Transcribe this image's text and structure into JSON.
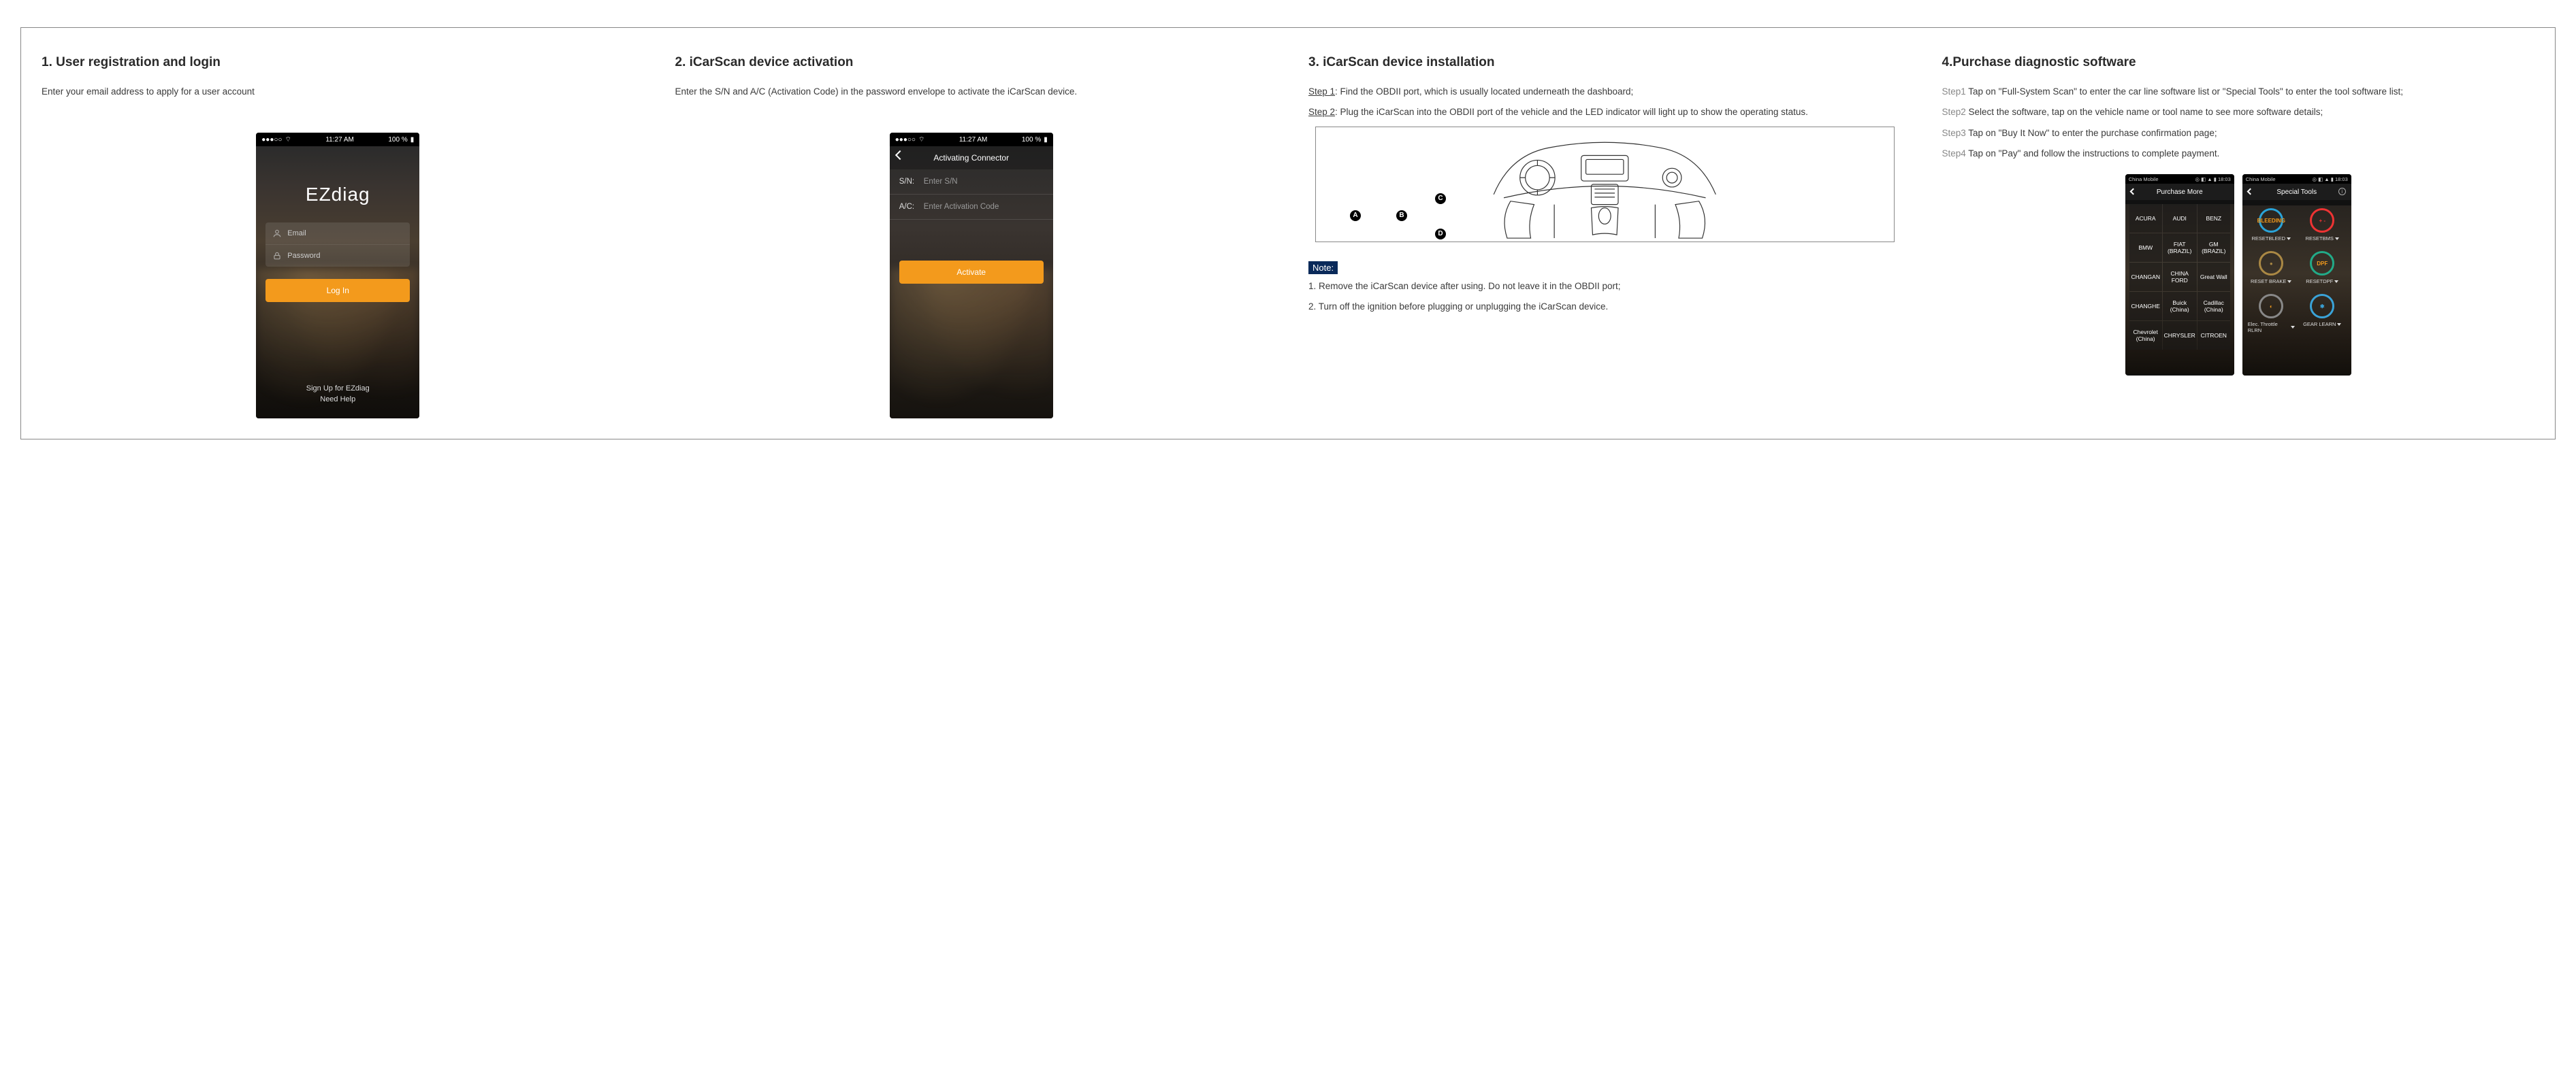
{
  "col1": {
    "title": "1. User registration and login",
    "desc": "Enter your email address to apply for a user account",
    "status_time": "11:27 AM",
    "status_batt": "100 %",
    "brand": "EZdiag",
    "email_placeholder": "Email",
    "password_placeholder": "Password",
    "login_btn": "Log In",
    "signup": "Sign Up for EZdiag",
    "help": "Need Help"
  },
  "col2": {
    "title": "2. iCarScan device activation",
    "desc": "Enter the S/N and A/C (Activation Code) in the password envelope to activate the iCarScan device.",
    "status_time": "11:27 AM",
    "status_batt": "100 %",
    "screen_title": "Activating Connector",
    "sn_label": "S/N:",
    "sn_placeholder": "Enter S/N",
    "ac_label": "A/C:",
    "ac_placeholder": "Enter Activation Code",
    "activate_btn": "Activate"
  },
  "col3": {
    "title": "3. iCarScan device installation",
    "step1_label": "Step 1",
    "step1_text": ": Find the OBDII port, which is usually located underneath the dashboard;",
    "step2_label": "Step 2",
    "step2_text": ": Plug the iCarScan into the OBDII port of the vehicle and the LED indicator will light up to show the operating status.",
    "dots": [
      "A",
      "B",
      "C",
      "D"
    ],
    "note_label": "Note:",
    "note1": "1. Remove the iCarScan device after using. Do not leave it in the OBDII port;",
    "note2": "2. Turn off the ignition before plugging or unplugging the iCarScan device."
  },
  "col4": {
    "title": "4.Purchase diagnostic software",
    "steps": [
      {
        "label": "Step1",
        "text": "  Tap on \"Full-System Scan\" to enter the car line software list or \"Special Tools\" to enter the tool software list;"
      },
      {
        "label": "Step2",
        "text": "  Select the software, tap on the vehicle name or tool name to see more software details;"
      },
      {
        "label": "Step3",
        "text": "  Tap on \"Buy It Now\" to enter the purchase confirmation page;"
      },
      {
        "label": "Step4",
        "text": "  Tap on \"Pay\" and follow the instructions to complete payment."
      }
    ],
    "phoneA": {
      "carrier": "China Mobile",
      "time": "18:03",
      "title": "Purchase More",
      "brands": [
        "ACURA",
        "AUDI",
        "BENZ",
        "BMW",
        "FIAT (BRAZIL)",
        "GM (BRAZIL)",
        "CHANGAN",
        "CHINA FORD",
        "Great Wall",
        "CHANGHE",
        "Buick (China)",
        "Cadillac (China)",
        "Chevrolet (China)",
        "CHRYSLER",
        "CITROEN"
      ]
    },
    "phoneB": {
      "carrier": "China Mobile",
      "time": "18:03",
      "title": "Special Tools",
      "tools": [
        {
          "name": "RESETBLEED",
          "badge": "BLEEDING",
          "color": "#f39a1c",
          "ring": "#2aa3d8"
        },
        {
          "name": "RESETBMS",
          "badge": "+ -",
          "color": "#e33",
          "ring": "#e33"
        },
        {
          "name": "RESET BRAKE",
          "badge": "●",
          "color": "#a84",
          "ring": "#a84"
        },
        {
          "name": "RESETDPF",
          "badge": "DPF",
          "color": "#f39a1c",
          "ring": "#2a8"
        },
        {
          "name": "Elec. Throttle RLRN",
          "badge": "◐",
          "color": "#f39a1c",
          "ring": "#888"
        },
        {
          "name": "GEAR LEARN",
          "badge": "✱",
          "color": "#3aa3d8",
          "ring": "#3aa3d8"
        }
      ]
    }
  }
}
